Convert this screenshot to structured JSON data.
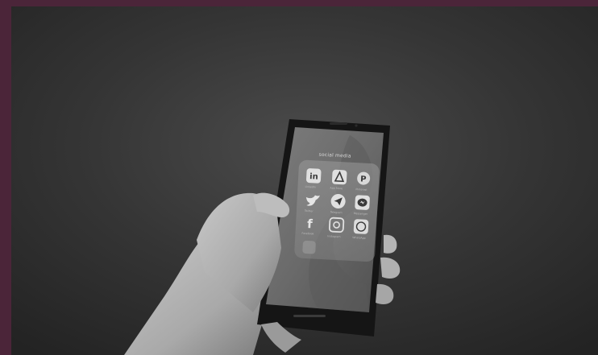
{
  "image": {
    "subject": "black-and-white photo of a hand holding a smartphone",
    "border_color": "#4b2539"
  },
  "phone_screen": {
    "folder_title": "social media",
    "apps": [
      {
        "icon": "linkedin-icon",
        "label": "LinkedIn"
      },
      {
        "icon": "app-store-icon",
        "label": "App Store"
      },
      {
        "icon": "pinterest-icon",
        "label": "Pinterest"
      },
      {
        "icon": "twitter-icon",
        "label": "Twitter"
      },
      {
        "icon": "telegram-icon",
        "label": "Telegram"
      },
      {
        "icon": "messenger-icon",
        "label": "Messenger"
      },
      {
        "icon": "facebook-icon",
        "label": "Facebook"
      },
      {
        "icon": "instagram-icon",
        "label": "Instagram"
      },
      {
        "icon": "whatsapp-icon",
        "label": "WhatsApp"
      }
    ]
  }
}
